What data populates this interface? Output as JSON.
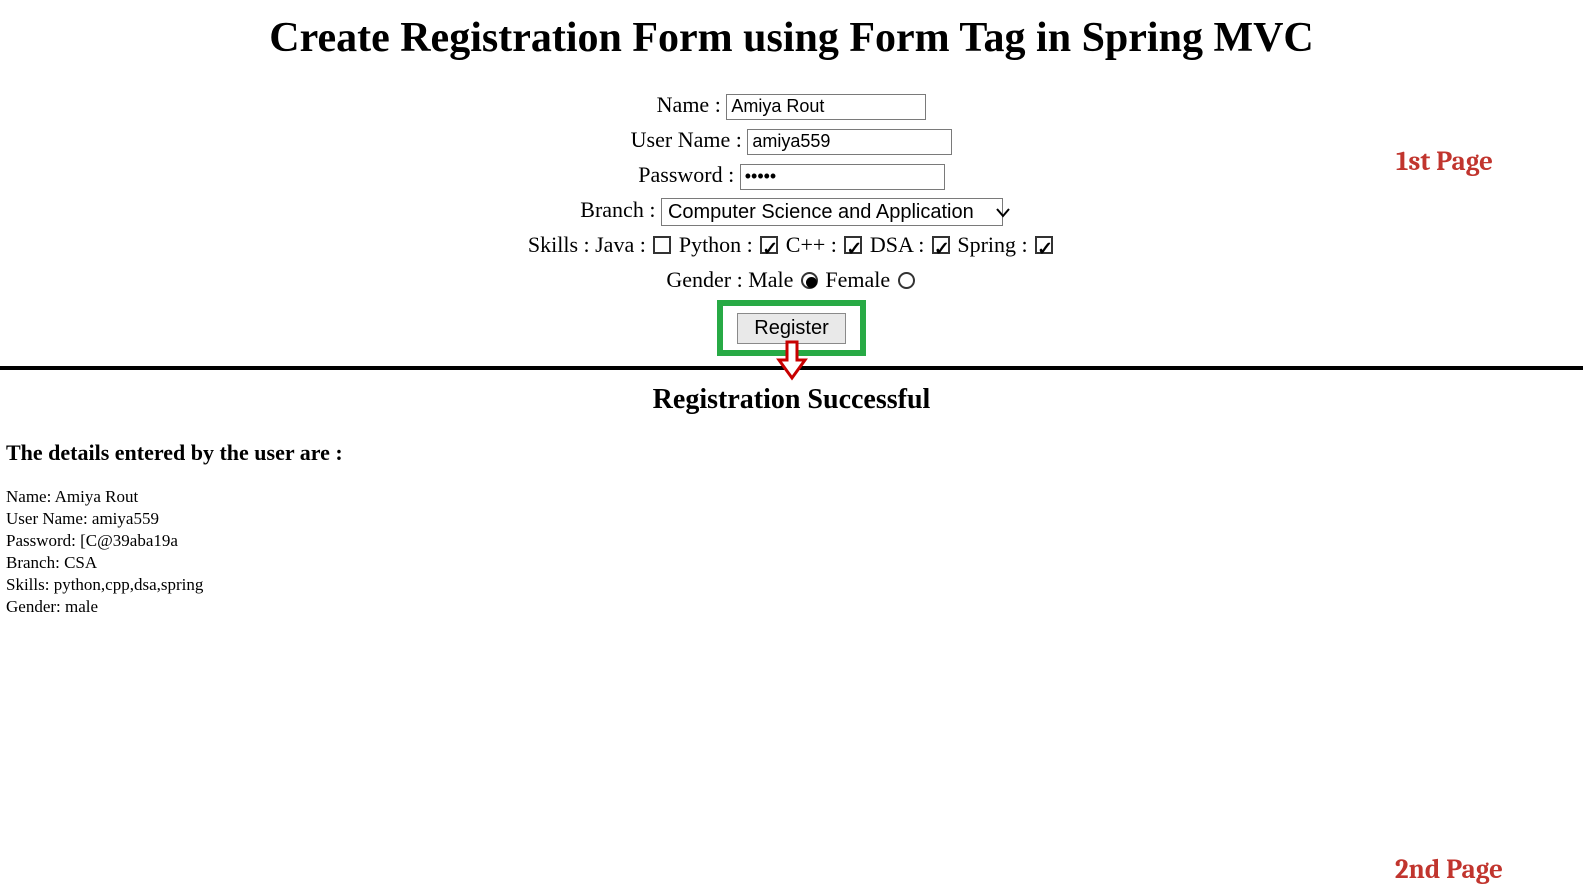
{
  "page1": {
    "title": "Create Registration Form using Form Tag in Spring MVC",
    "annotation": "1st Page",
    "labels": {
      "name": "Name :",
      "username": "User Name :",
      "password": "Password :",
      "branch": "Branch :",
      "skills": "Skills :",
      "gender": "Gender :"
    },
    "values": {
      "name": "Amiya Rout",
      "username": "amiya559",
      "password": "•••••",
      "branch_selected": "Computer Science and Application"
    },
    "skills": [
      {
        "label": "Java :",
        "checked": false
      },
      {
        "label": "Python :",
        "checked": true
      },
      {
        "label": "C++ :",
        "checked": true
      },
      {
        "label": "DSA :",
        "checked": true
      },
      {
        "label": "Spring :",
        "checked": true
      }
    ],
    "gender": [
      {
        "label": "Male",
        "checked": true
      },
      {
        "label": "Female",
        "checked": false
      }
    ],
    "register_label": "Register"
  },
  "page2": {
    "annotation": "2nd Page",
    "title": "Registration Successful",
    "details_heading": "The details entered by the user are :",
    "details": [
      "Name: Amiya Rout",
      "User Name: amiya559",
      "Password: [C@39aba19a",
      "Branch: CSA",
      "Skills: python,cpp,dsa,spring",
      "Gender: male"
    ]
  }
}
